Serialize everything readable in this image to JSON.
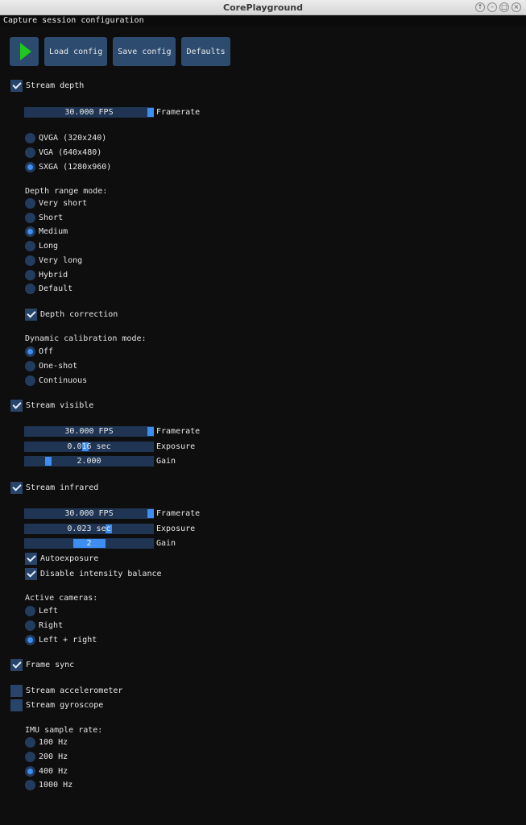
{
  "window": {
    "title": "CorePlayground"
  },
  "menubar": {
    "title": "Capture session configuration"
  },
  "toolbar": {
    "load": "Load config",
    "save": "Save config",
    "defaults": "Defaults"
  },
  "depth": {
    "stream": "Stream depth",
    "framerate": {
      "value": "30.000 FPS",
      "label": "Framerate",
      "level": 1.0
    },
    "resolutions": [
      "QVGA (320x240)",
      "VGA (640x480)",
      "SXGA (1280x960)"
    ],
    "resolution_selected": 2,
    "range_title": "Depth range mode:",
    "ranges": [
      "Very short",
      "Short",
      "Medium",
      "Long",
      "Very long",
      "Hybrid",
      "Default"
    ],
    "range_selected": 2,
    "correction": "Depth correction",
    "calib_title": "Dynamic calibration mode:",
    "calib": [
      "Off",
      "One-shot",
      "Continuous"
    ],
    "calib_selected": 0
  },
  "visible": {
    "stream": "Stream visible",
    "framerate": {
      "value": "30.000 FPS",
      "label": "Framerate",
      "level": 1.0
    },
    "exposure": {
      "value": "0.016 sec",
      "label": "Exposure",
      "level": 0.47
    },
    "gain": {
      "value": "2.000",
      "label": "Gain",
      "level": 0.17
    }
  },
  "infrared": {
    "stream": "Stream infrared",
    "framerate": {
      "value": "30.000 FPS",
      "label": "Framerate",
      "level": 1.0
    },
    "exposure": {
      "value": "0.023 sec",
      "label": "Exposure",
      "level": 0.66
    },
    "gain": {
      "value": "2",
      "label": "Gain",
      "level": 0.5
    },
    "autoexposure": "Autoexposure",
    "disable_balance": "Disable intensity balance",
    "cameras_title": "Active cameras:",
    "cameras": [
      "Left",
      "Right",
      "Left + right"
    ],
    "cameras_selected": 2
  },
  "frame_sync": "Frame sync",
  "imu": {
    "accelerometer": "Stream accelerometer",
    "gyroscope": "Stream gyroscope",
    "rate_title": "IMU sample rate:",
    "rates": [
      "100 Hz",
      "200 Hz",
      "400 Hz",
      "1000 Hz"
    ],
    "rate_selected": 2
  },
  "colors": {
    "accent": "#3d8ef0",
    "frame": "#2c4b6f",
    "play": "#1ec81e",
    "background": "#0e0e0e"
  }
}
